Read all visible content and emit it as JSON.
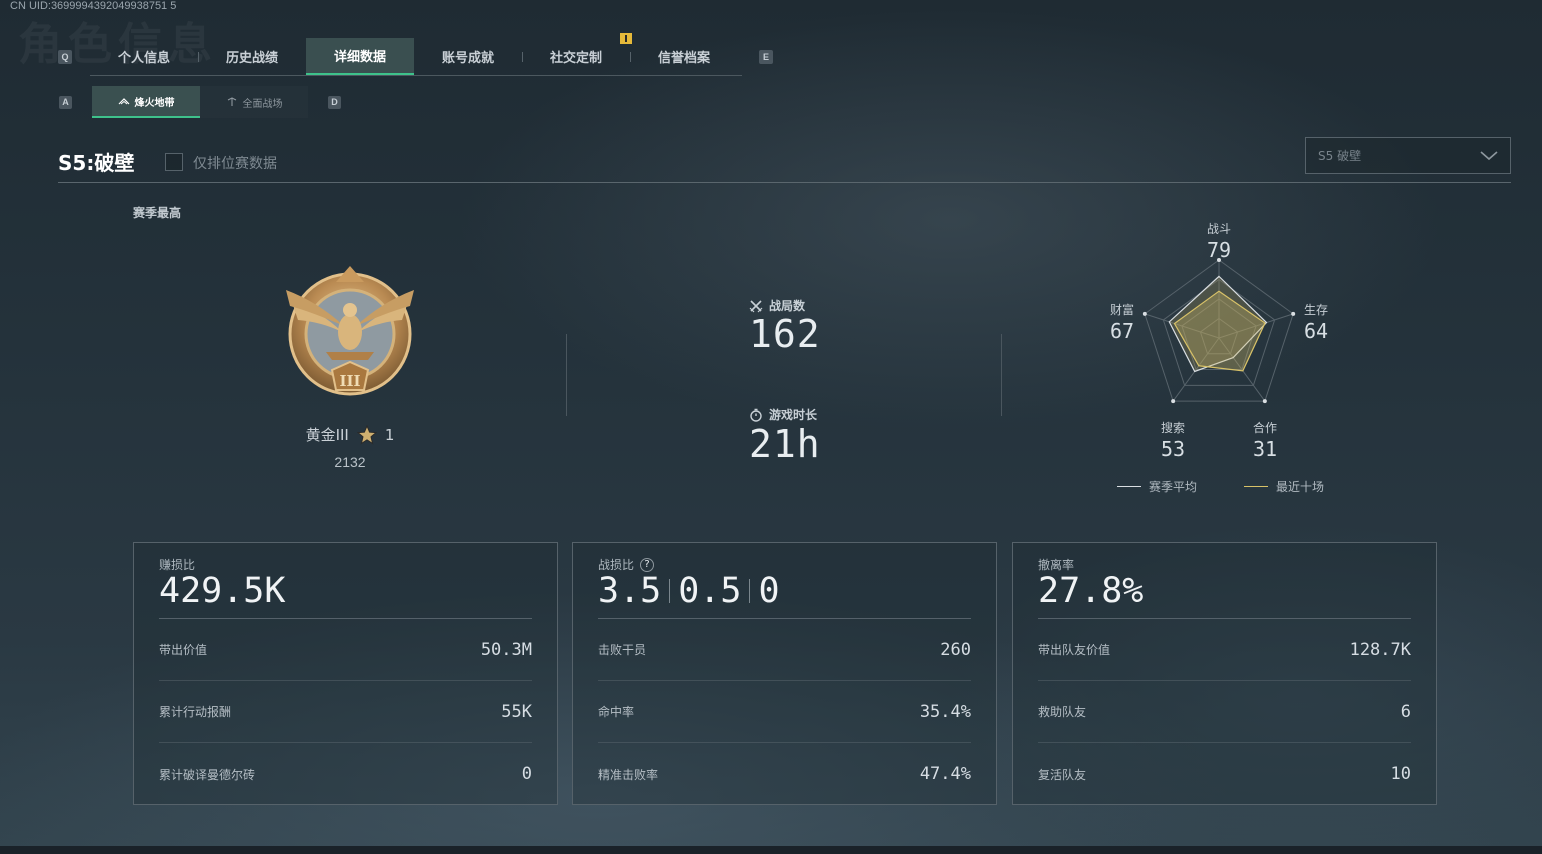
{
  "uid_text": "CN UID:3699994392049938751 5",
  "bg_watermark": "角色信息",
  "key_hints": {
    "prev_tab": "Q",
    "next_tab": "E",
    "prev_sub": "A",
    "next_sub": "D"
  },
  "tabs": [
    {
      "label": "个人信息",
      "active": false
    },
    {
      "label": "历史战绩",
      "active": false
    },
    {
      "label": "详细数据",
      "active": true
    },
    {
      "label": "账号成就",
      "active": false
    },
    {
      "label": "社交定制",
      "active": false
    },
    {
      "label": "信誉档案",
      "active": false
    }
  ],
  "subtabs": [
    {
      "label": "烽火地带",
      "icon": "fire-zone-icon",
      "active": true
    },
    {
      "label": "全面战场",
      "icon": "battlefield-icon",
      "active": false
    }
  ],
  "season": {
    "title": "S5:破壁",
    "ranked_only_label": "仅排位赛数据",
    "select_value": "S5 破壁"
  },
  "season_best": {
    "label": "赛季最高",
    "rank_name": "黄金III",
    "stars": "1",
    "score": "2132"
  },
  "summary": {
    "matches_label": "战局数",
    "matches_value": "162",
    "playtime_label": "游戏时长",
    "playtime_value": "21h"
  },
  "radar": {
    "axes": [
      {
        "label": "战斗",
        "value": "79"
      },
      {
        "label": "生存",
        "value": "64"
      },
      {
        "label": "合作",
        "value": "31"
      },
      {
        "label": "搜索",
        "value": "53"
      },
      {
        "label": "财富",
        "value": "67"
      }
    ],
    "season_avg_values": [
      79,
      64,
      31,
      53,
      67
    ],
    "recent_ten_values": [
      60,
      62,
      52,
      44,
      60
    ],
    "legend": {
      "season_avg": "赛季平均",
      "recent_ten": "最近十场"
    },
    "colors": {
      "season_avg": "#d9dee2",
      "recent_ten": "#d8c268"
    }
  },
  "cards": [
    {
      "title": "赚损比",
      "big": "429.5K",
      "rows": [
        {
          "label": "带出价值",
          "value": "50.3M"
        },
        {
          "label": "累计行动报酬",
          "value": "55K"
        },
        {
          "label": "累计破译曼德尔砖",
          "value": "0"
        }
      ]
    },
    {
      "title": "战损比",
      "big_parts": [
        "3.5",
        "0.5",
        "0"
      ],
      "help": "?",
      "rows": [
        {
          "label": "击败干员",
          "value": "260"
        },
        {
          "label": "命中率",
          "value": "35.4%"
        },
        {
          "label": "精准击败率",
          "value": "47.4%"
        }
      ]
    },
    {
      "title": "撤离率",
      "big": "27.8%",
      "rows": [
        {
          "label": "带出队友价值",
          "value": "128.7K"
        },
        {
          "label": "救助队友",
          "value": "6"
        },
        {
          "label": "复活队友",
          "value": "10"
        }
      ]
    }
  ],
  "colors": {
    "accent": "#3ec28b",
    "notification": "#e5b93a",
    "medal_gold": "#c89a5a"
  }
}
